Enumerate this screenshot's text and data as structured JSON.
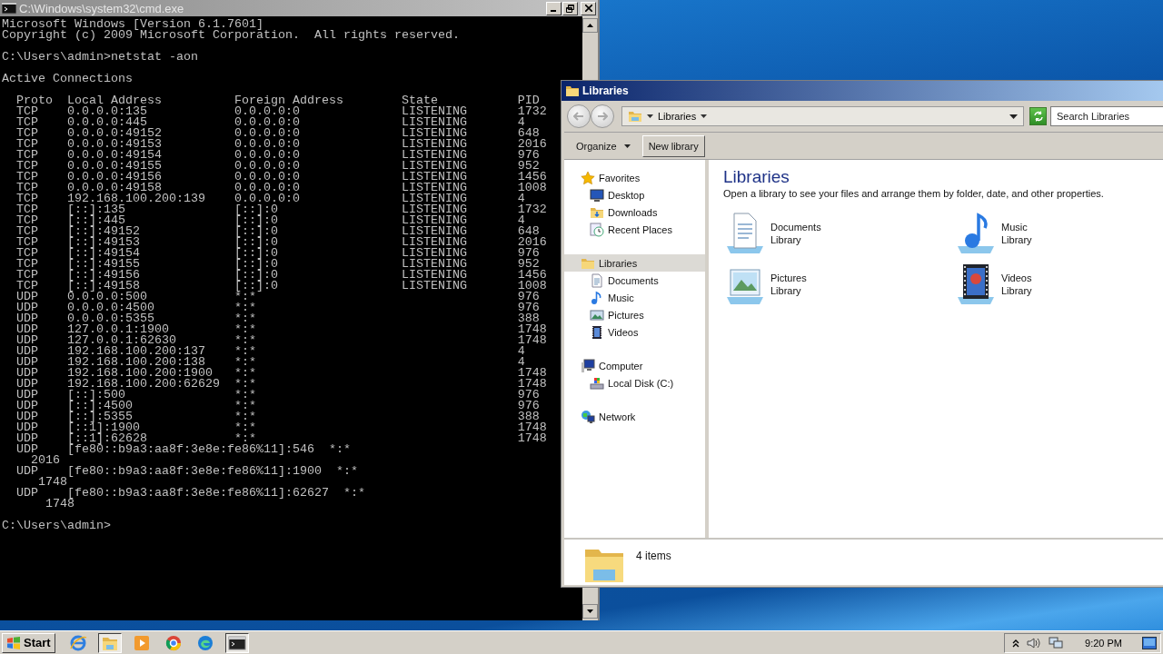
{
  "console_window": {
    "title": "C:\\Windows\\system32\\cmd.exe",
    "blocks": [
      [
        "Microsoft Windows [Version 6.1.7601]",
        "Copyright (c) 2009 Microsoft Corporation.  All rights reserved."
      ],
      [
        "C:\\Users\\admin>netstat -aon"
      ],
      [
        "Active Connections"
      ],
      [
        "  Proto  Local Address          Foreign Address        State           PID",
        "  TCP    0.0.0.0:135            0.0.0.0:0              LISTENING       1732",
        "  TCP    0.0.0.0:445            0.0.0.0:0              LISTENING       4",
        "  TCP    0.0.0.0:49152          0.0.0.0:0              LISTENING       648",
        "  TCP    0.0.0.0:49153          0.0.0.0:0              LISTENING       2016",
        "  TCP    0.0.0.0:49154          0.0.0.0:0              LISTENING       976",
        "  TCP    0.0.0.0:49155          0.0.0.0:0              LISTENING       952",
        "  TCP    0.0.0.0:49156          0.0.0.0:0              LISTENING       1456",
        "  TCP    0.0.0.0:49158          0.0.0.0:0              LISTENING       1008",
        "  TCP    192.168.100.200:139    0.0.0.0:0              LISTENING       4",
        "  TCP    [::]:135               [::]:0                 LISTENING       1732",
        "  TCP    [::]:445               [::]:0                 LISTENING       4",
        "  TCP    [::]:49152             [::]:0                 LISTENING       648",
        "  TCP    [::]:49153             [::]:0                 LISTENING       2016",
        "  TCP    [::]:49154             [::]:0                 LISTENING       976",
        "  TCP    [::]:49155             [::]:0                 LISTENING       952",
        "  TCP    [::]:49156             [::]:0                 LISTENING       1456",
        "  TCP    [::]:49158             [::]:0                 LISTENING       1008",
        "  UDP    0.0.0.0:500            *:*                                    976",
        "  UDP    0.0.0.0:4500           *:*                                    976",
        "  UDP    0.0.0.0:5355           *:*                                    388",
        "  UDP    127.0.0.1:1900         *:*                                    1748",
        "  UDP    127.0.0.1:62630        *:*                                    1748",
        "  UDP    192.168.100.200:137    *:*                                    4",
        "  UDP    192.168.100.200:138    *:*                                    4",
        "  UDP    192.168.100.200:1900   *:*                                    1748",
        "  UDP    192.168.100.200:62629  *:*                                    1748",
        "  UDP    [::]:500               *:*                                    976",
        "  UDP    [::]:4500              *:*                                    976",
        "  UDP    [::]:5355              *:*                                    388",
        "  UDP    [::1]:1900             *:*                                    1748",
        "  UDP    [::1]:62628            *:*                                    1748",
        "  UDP    [fe80::b9a3:aa8f:3e8e:fe86%11]:546  *:*",
        "    2016",
        "  UDP    [fe80::b9a3:aa8f:3e8e:fe86%11]:1900  *:*",
        "     1748",
        "  UDP    [fe80::b9a3:aa8f:3e8e:fe86%11]:62627  *:*",
        "      1748"
      ],
      [
        "C:\\Users\\admin>"
      ]
    ]
  },
  "explorer_window": {
    "title": "Libraries",
    "breadcrumb": "Libraries",
    "search": {
      "placeholder": "Search Libraries"
    },
    "toolbar": {
      "organize": "Organize",
      "new_library": "New library"
    },
    "nav": [
      {
        "label": "Favorites",
        "kind": "star",
        "selected": false,
        "children": [
          {
            "label": "Desktop",
            "kind": "desktop",
            "selected": false
          },
          {
            "label": "Downloads",
            "kind": "downloads",
            "selected": false
          },
          {
            "label": "Recent Places",
            "kind": "recent",
            "selected": false
          }
        ]
      },
      {
        "label": "Libraries",
        "kind": "libraries",
        "selected": true,
        "children": [
          {
            "label": "Documents",
            "kind": "documents",
            "selected": false
          },
          {
            "label": "Music",
            "kind": "music",
            "selected": false
          },
          {
            "label": "Pictures",
            "kind": "pictures",
            "selected": false
          },
          {
            "label": "Videos",
            "kind": "videos",
            "selected": false
          }
        ]
      },
      {
        "label": "Computer",
        "kind": "computer",
        "selected": false,
        "children": [
          {
            "label": "Local Disk (C:)",
            "kind": "disk",
            "selected": false
          }
        ]
      },
      {
        "label": "Network",
        "kind": "network",
        "selected": false
      }
    ],
    "heading": "Libraries",
    "description": "Open a library to see your files and arrange them by folder, date, and other properties.",
    "items": [
      {
        "name": "Documents",
        "subtitle": "Library",
        "kind": "documents"
      },
      {
        "name": "Music",
        "subtitle": "Library",
        "kind": "music"
      },
      {
        "name": "Pictures",
        "subtitle": "Library",
        "kind": "pictures"
      },
      {
        "name": "Videos",
        "subtitle": "Library",
        "kind": "videos"
      }
    ],
    "status": "4 items"
  },
  "taskbar": {
    "start": "Start",
    "apps": [
      {
        "kind": "ie",
        "active": false
      },
      {
        "kind": "explorer",
        "active": true
      },
      {
        "kind": "media",
        "active": false
      },
      {
        "kind": "chrome",
        "active": false
      },
      {
        "kind": "edge",
        "active": false
      },
      {
        "kind": "cmd",
        "active": true
      }
    ],
    "clock": "9:20 PM"
  }
}
